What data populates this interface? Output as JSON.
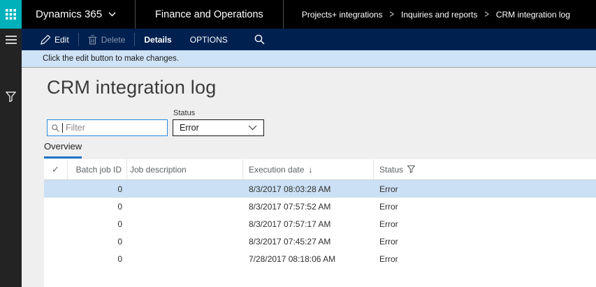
{
  "topbar": {
    "product_label": "Dynamics 365",
    "suite_label": "Finance and Operations",
    "breadcrumb": [
      "Projects+ integrations",
      "Inquiries and reports",
      "CRM integration log"
    ],
    "breadcrumb_separator": ">"
  },
  "toolbar": {
    "edit_label": "Edit",
    "delete_label": "Delete",
    "details_label": "Details",
    "options_label": "OPTIONS"
  },
  "notification": {
    "message": "Click the edit button to make changes."
  },
  "page": {
    "title": "CRM integration log"
  },
  "filters": {
    "search_placeholder": "Filter",
    "status_label": "Status",
    "status_value": "Error"
  },
  "tabs": {
    "overview_label": "Overview"
  },
  "grid": {
    "header_check": "✓",
    "sort_indicator": "↓",
    "columns": {
      "batch_job_id": "Batch job ID",
      "job_description": "Job description",
      "execution_date": "Execution date",
      "status": "Status"
    },
    "rows": [
      {
        "batch_job_id": "0",
        "job_description": "",
        "execution_date": "8/3/2017 08:03:28 AM",
        "status": "Error",
        "selected": true
      },
      {
        "batch_job_id": "0",
        "job_description": "",
        "execution_date": "8/3/2017 07:57:52 AM",
        "status": "Error",
        "selected": false
      },
      {
        "batch_job_id": "0",
        "job_description": "",
        "execution_date": "8/3/2017 07:57:17 AM",
        "status": "Error",
        "selected": false
      },
      {
        "batch_job_id": "0",
        "job_description": "",
        "execution_date": "8/3/2017 07:45:27 AM",
        "status": "Error",
        "selected": false
      },
      {
        "batch_job_id": "0",
        "job_description": "",
        "execution_date": "7/28/2017 08:18:06 AM",
        "status": "Error",
        "selected": false
      }
    ]
  },
  "colors": {
    "app_launcher_teal": "#00b0ba",
    "topbar_black": "#000000",
    "toolbar_navy": "#002050",
    "notification_blue": "#cfe3f7",
    "selected_row_blue": "#cbe0f4",
    "tab_accent_blue": "#2073c4",
    "filter_border_blue": "#2b88d8"
  }
}
